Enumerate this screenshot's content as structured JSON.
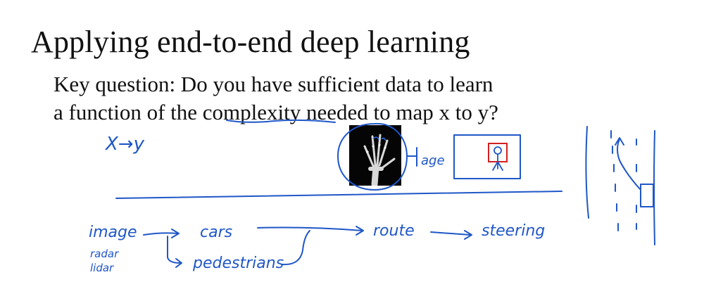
{
  "slide": {
    "title": "Applying end-to-end deep learning",
    "question_line1": "Key question: Do you have sufficient data to learn",
    "question_line2_prefix": "a function of the ",
    "question_line2_underlined": "complexity",
    "question_line2_suffix": " needed to map x to y?"
  },
  "handwriting": {
    "x_to_y": "X→y",
    "age": "age",
    "image": "image",
    "radar": "radar",
    "lidar": "lidar",
    "cars": "cars",
    "pedestrians": "pedestrians",
    "route": "route",
    "steering": "steering"
  },
  "colors": {
    "text": "#111111",
    "ink_blue": "#1f57c7",
    "ink_red": "#d22020"
  }
}
